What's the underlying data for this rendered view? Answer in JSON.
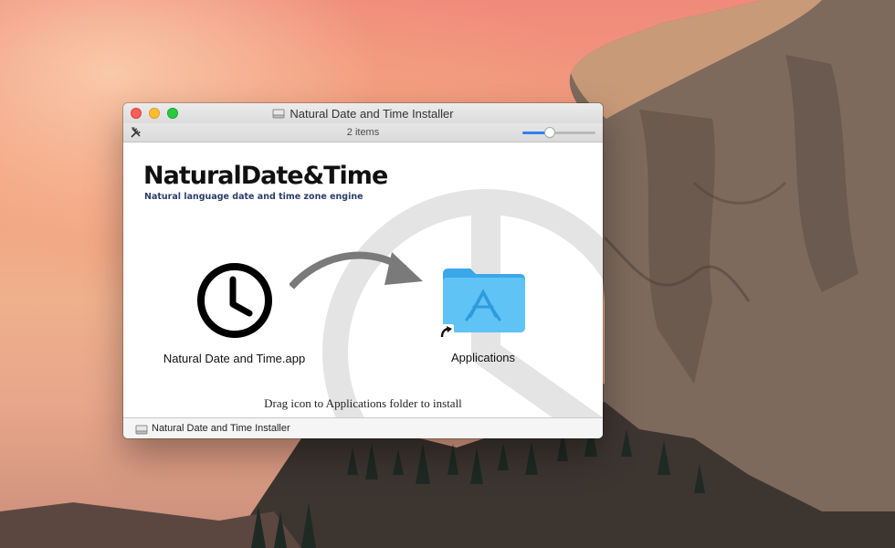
{
  "window": {
    "title": "Natural Date and Time Installer",
    "item_count": "2 items",
    "icon_size_slider": 0.35
  },
  "content": {
    "brand_name": "NaturalDate&Time",
    "tagline": "Natural language date and time zone engine",
    "app_label": "Natural Date and Time.app",
    "folder_label": "Applications",
    "instruction": "Drag icon to Applications folder to install"
  },
  "path_bar": {
    "label": "Natural Date and Time Installer"
  },
  "icons": {
    "disk": "disk-icon",
    "tools": "tools-icon",
    "clock": "clock-icon",
    "arrow": "curved-arrow-icon",
    "folder": "applications-folder-icon",
    "alias": "alias-badge-icon"
  },
  "colors": {
    "folder": "#4fb7f2",
    "slider_accent": "#2f7ff3"
  }
}
